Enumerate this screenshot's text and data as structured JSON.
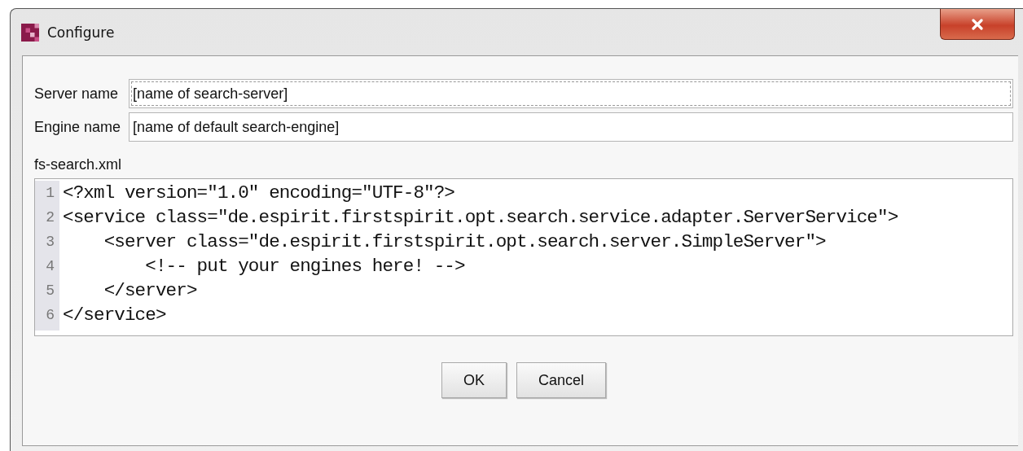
{
  "window": {
    "title": "Configure"
  },
  "fields": [
    {
      "label": "Server name",
      "value": "[name of search-server]",
      "focused": true
    },
    {
      "label": "Engine name",
      "value": "[name of default search-engine]",
      "focused": false
    }
  ],
  "editor": {
    "label": "fs-search.xml",
    "lines": [
      {
        "number": "1",
        "text": "<?xml version=\"1.0\" encoding=\"UTF-8\"?>"
      },
      {
        "number": "2",
        "text": "<service class=\"de.espirit.firstspirit.opt.search.service.adapter.ServerService\">"
      },
      {
        "number": "3",
        "text": "    <server class=\"de.espirit.firstspirit.opt.search.server.SimpleServer\">"
      },
      {
        "number": "4",
        "text": "        <!-- put your engines here! -->"
      },
      {
        "number": "5",
        "text": "    </server>"
      },
      {
        "number": "6",
        "text": "</service>"
      }
    ]
  },
  "buttons": [
    "OK",
    "Cancel"
  ]
}
